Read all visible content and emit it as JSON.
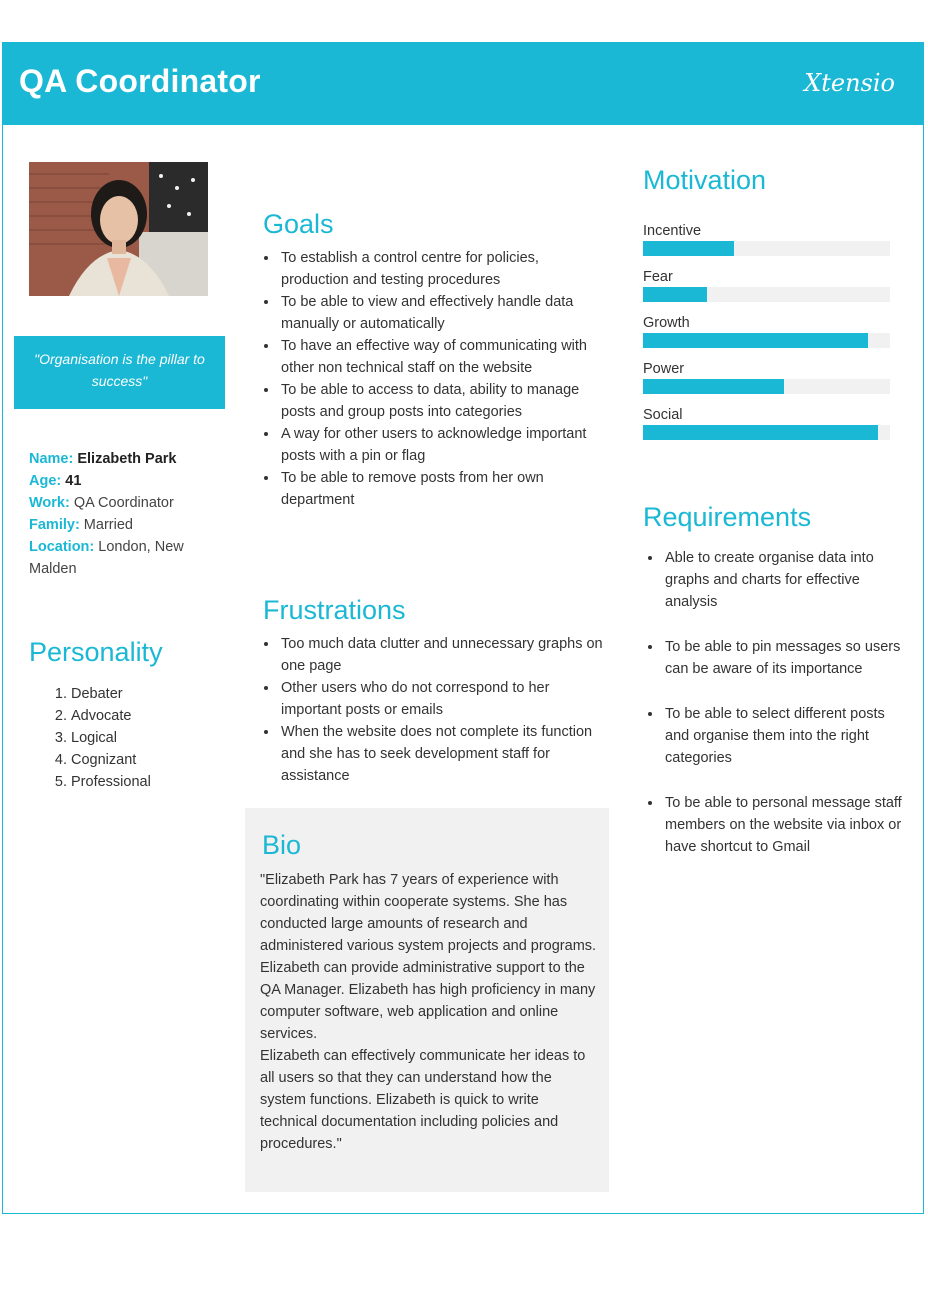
{
  "header": {
    "title": "QA Coordinator",
    "logo": "Xtensio"
  },
  "quote": "\"Organisation is the pillar to success\"",
  "profile": {
    "name_label": "Name",
    "name": "Elizabeth Park",
    "age_label": "Age",
    "age": "41",
    "work_label": "Work",
    "work": "QA Coordinator",
    "family_label": "Family",
    "family": "Married",
    "location_label": "Location",
    "location": "London, New Malden"
  },
  "personality": {
    "title": "Personality",
    "items": [
      "Debater",
      "Advocate",
      "Logical",
      "Cognizant",
      "Professional"
    ]
  },
  "goals": {
    "title": "Goals",
    "items": [
      "To establish a control centre for policies, production and testing procedures",
      "To be able to view and effectively handle data manually or automatically",
      "To have an effective way of communicating with other non technical staff on the website",
      "To be able to access to data, ability to manage posts and group posts into categories",
      "A way for other users to acknowledge important posts with a pin or flag",
      "To be able to remove posts from her own department"
    ]
  },
  "frustrations": {
    "title": "Frustrations",
    "items": [
      "Too much data clutter and unnecessary graphs on one page",
      "Other users who do not correspond to her important posts or emails",
      "When the website does not complete its function and she has to seek development staff for assistance"
    ]
  },
  "bio": {
    "title": "Bio",
    "paragraphs": [
      "\"Elizabeth Park has 7 years of experience with coordinating within cooperate systems. She has conducted large amounts of research and administered various system projects and programs.",
      "Elizabeth can provide administrative support to the QA Manager. Elizabeth has high proficiency in many computer software, web application and online services.",
      "Elizabeth can effectively communicate her ideas to all users so that they can understand how the system functions. Elizabeth is quick to write technical documentation including policies and procedures.\""
    ]
  },
  "motivation": {
    "title": "Motivation",
    "items": [
      {
        "label": "Incentive",
        "level": 0.37
      },
      {
        "label": "Fear",
        "level": 0.26
      },
      {
        "label": "Growth",
        "level": 0.91
      },
      {
        "label": "Power",
        "level": 0.57
      },
      {
        "label": "Social",
        "level": 0.95
      }
    ]
  },
  "requirements": {
    "title": "Requirements",
    "items": [
      "Able to create organise data into graphs and charts for effective analysis",
      "To be able to pin messages so users can be aware of its importance",
      "To be able to select different posts and organise them into the right categories",
      "To be able to personal message staff members on the website via inbox or have shortcut to Gmail"
    ]
  },
  "colors": {
    "accent": "#1ab8d5",
    "panel": "#f1f1f1"
  }
}
